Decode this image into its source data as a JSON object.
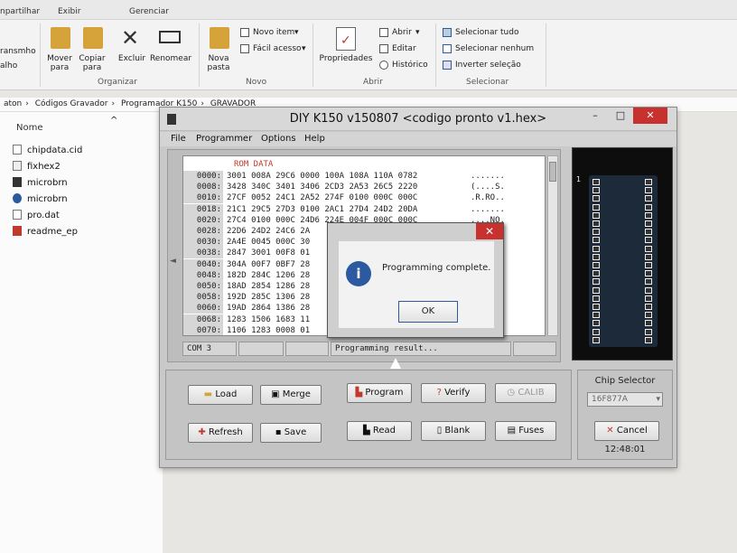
{
  "ribbon": {
    "tabs": [
      "npartilhar",
      "Exibir",
      "Gerenciar"
    ],
    "left_labels": [
      "ransmho",
      "alho"
    ],
    "organizar": {
      "mover": "Mover\npara",
      "copiar": "Copiar\npara",
      "excluir": "Excluir",
      "renomear": "Renomear",
      "group": "Organizar"
    },
    "novo": {
      "nova_pasta": "Nova\npasta",
      "novo_item": "Novo item",
      "facil_acesso": "Fácil acesso",
      "group": "Novo"
    },
    "abrir": {
      "propriedades": "Propriedades",
      "abrir": "Abrir",
      "editar": "Editar",
      "historico": "Histórico",
      "group": "Abrir"
    },
    "selecionar": {
      "tudo": "Selecionar tudo",
      "nenhum": "Selecionar nenhum",
      "inverter": "Inverter seleção",
      "group": "Selecionar"
    }
  },
  "breadcrumb": [
    "aton",
    "Códigos Gravador",
    "Programador K150",
    "GRAVADOR"
  ],
  "explorer": {
    "column": "Nome",
    "files": [
      "chipdata.cid",
      "fixhex2",
      "microbrn",
      "microbrn",
      "pro.dat",
      "readme_ep"
    ]
  },
  "window": {
    "title": "DIY K150 v150807  <codigo pronto v1.hex>",
    "menus": [
      "File",
      "Programmer",
      "Options",
      "Help"
    ],
    "rom_title": "ROM DATA",
    "rom_rows": [
      {
        "addr": "0000:",
        "hex": "3001 008A 29C6 0000 100A 108A 110A 0782",
        "ascii": "......."
      },
      {
        "addr": "0008:",
        "hex": "3428 340C 3401 3406 2CD3 2A53 26C5 2220",
        "ascii": "(....S."
      },
      {
        "addr": "0010:",
        "hex": "27CF 0052 24C1 2A52 274F 0100 000C 000C",
        "ascii": ".R.RO.."
      },
      {
        "addr": "0018:",
        "hex": "21C1 29C5 27D3 0100 2AC1 27D4 24D2 20DA",
        "ascii": "......."
      },
      {
        "addr": "0020:",
        "hex": "27C4 0100 000C 24D6 224E 004F 000C 000C",
        "ascii": "....NO."
      },
      {
        "addr": "0028:",
        "hex": "22D6 24D2 24C6 2A",
        "ascii": ""
      },
      {
        "addr": "0030:",
        "hex": "2A4E 0045 000C 30",
        "ascii": ""
      },
      {
        "addr": "0038:",
        "hex": "2847 3001 00F8 01",
        "ascii": ""
      },
      {
        "addr": "0040:",
        "hex": "304A 00F7 0BF7 28",
        "ascii": "9"
      },
      {
        "addr": "0048:",
        "hex": "182D 284C 1206 28",
        "ascii": ""
      },
      {
        "addr": "0050:",
        "hex": "18AD 2854 1286 28",
        "ascii": ""
      },
      {
        "addr": "0058:",
        "hex": "192D 285C 1306 28",
        "ascii": ""
      },
      {
        "addr": "0060:",
        "hex": "19AD 2864 1386 28",
        "ascii": ""
      },
      {
        "addr": "0068:",
        "hex": "1283 1506 1683 11",
        "ascii": ""
      },
      {
        "addr": "0070:",
        "hex": "1106 1283 0008 01",
        "ascii": ""
      }
    ],
    "status": {
      "port": "COM 3",
      "result": "Programming result..."
    },
    "buttons": {
      "load": "Load",
      "merge": "Merge",
      "refresh": "Refresh",
      "save": "Save",
      "program": "Program",
      "verify": "Verify",
      "calib": "CALIB",
      "read": "Read",
      "blank": "Blank",
      "fuses": "Fuses"
    },
    "chip_selector": {
      "label": "Chip Selector",
      "value": "16F877A",
      "cancel": "Cancel",
      "time": "12:48:01"
    },
    "chip_pin_mark": "1"
  },
  "dialog": {
    "message": "Programming complete.",
    "ok": "OK"
  },
  "colors": {
    "accent": "#2b5aa0",
    "close": "#c7312e"
  }
}
